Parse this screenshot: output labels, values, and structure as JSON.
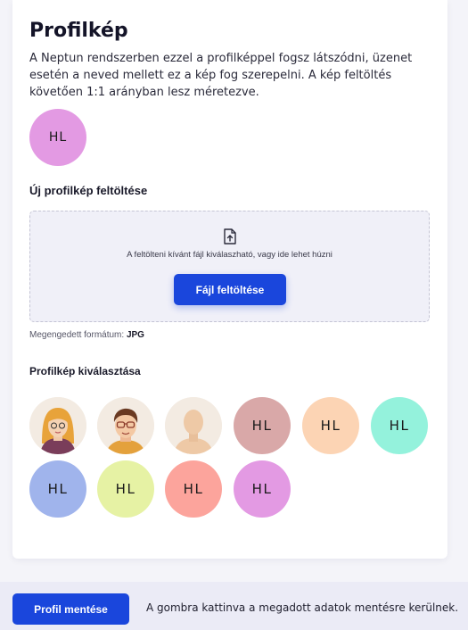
{
  "profile": {
    "title": "Profilkép",
    "description": "A Neptun rendszerben ezzel a profilképpel fogsz látszódni, üzenet esetén a neved mellett ez a kép fog szerepelni. A kép feltöltés követően 1:1 arányban lesz méretezve.",
    "current_initials": "HL",
    "current_color": "#e39ae3"
  },
  "upload": {
    "title": "Új profilkép feltöltése",
    "icon": "file-upload-icon",
    "drop_text": "A feltölteni kívánt fájl kiválaszható, vagy ide lehet húzni",
    "button_label": "Fájl feltöltése",
    "formats_label": "Megengedett formátum:",
    "formats_value": "JPG"
  },
  "selection": {
    "title": "Profilkép kiválasztása",
    "options": [
      {
        "type": "illustration",
        "icon": "woman-avatar-icon"
      },
      {
        "type": "illustration",
        "icon": "man-glasses-avatar-icon"
      },
      {
        "type": "illustration",
        "icon": "silhouette-avatar-icon"
      },
      {
        "type": "initials",
        "label": "HL",
        "color": "#d9a8a8"
      },
      {
        "type": "initials",
        "label": "HL",
        "color": "#fcd4b4"
      },
      {
        "type": "initials",
        "label": "HL",
        "color": "#94f2dc"
      },
      {
        "type": "initials",
        "label": "HL",
        "color": "#a0b4ec"
      },
      {
        "type": "initials",
        "label": "HL",
        "color": "#e6f2a4"
      },
      {
        "type": "initials",
        "label": "HL",
        "color": "#fca49c"
      },
      {
        "type": "initials",
        "label": "HL",
        "color": "#e39ae3"
      }
    ]
  },
  "footer": {
    "save_label": "Profil mentése",
    "note": "A gombra kattinva a megadott adatok mentésre kerülnek."
  }
}
